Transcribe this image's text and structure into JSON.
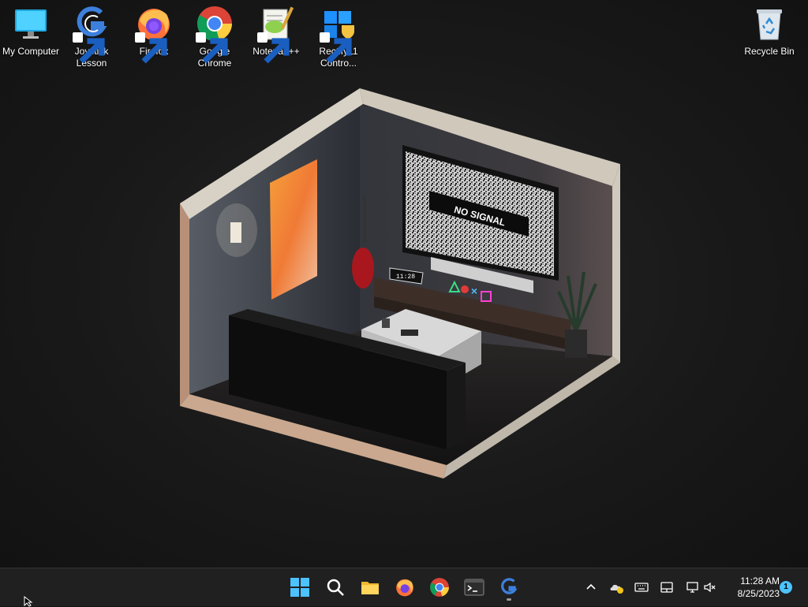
{
  "desktop": {
    "icons": [
      {
        "label": "My Computer",
        "icon": "monitor-icon",
        "shortcut": false
      },
      {
        "label": "Joystick Lesson",
        "icon": "joystick-lesson-icon",
        "shortcut": true
      },
      {
        "label": "Firefox",
        "icon": "firefox-icon",
        "shortcut": true
      },
      {
        "label": "Google Chrome",
        "icon": "chrome-icon",
        "shortcut": true
      },
      {
        "label": "Notepad++",
        "icon": "notepadpp-icon",
        "shortcut": true
      },
      {
        "label": "Rectify11 Contro...",
        "icon": "rectify11-icon",
        "shortcut": true
      },
      {
        "label": "Recycle Bin",
        "icon": "recycle-bin-icon",
        "shortcut": false
      }
    ]
  },
  "wallpaper": {
    "tv_text": "NO SIGNAL",
    "clock_text": "11:28"
  },
  "taskbar": {
    "pinned": [
      {
        "name": "start",
        "icon": "windows-logo-icon"
      },
      {
        "name": "search",
        "icon": "search-icon"
      },
      {
        "name": "file-explorer",
        "icon": "folder-icon"
      },
      {
        "name": "firefox",
        "icon": "firefox-icon"
      },
      {
        "name": "chrome",
        "icon": "chrome-icon"
      },
      {
        "name": "terminal",
        "icon": "terminal-icon"
      },
      {
        "name": "joystick-lesson",
        "icon": "joystick-lesson-icon",
        "running": true
      }
    ],
    "tray": {
      "icons": [
        "chevron-up-icon",
        "onedrive-icon",
        "keyboard-icon",
        "touchpad-icon",
        "network-icon",
        "volume-muted-icon"
      ],
      "time": "11:28 AM",
      "date": "8/25/2023",
      "notification_count": "1"
    }
  },
  "colors": {
    "taskbar_bg": "#202020",
    "accent": "#4cc2ff",
    "desktop_bg": "#161616"
  }
}
